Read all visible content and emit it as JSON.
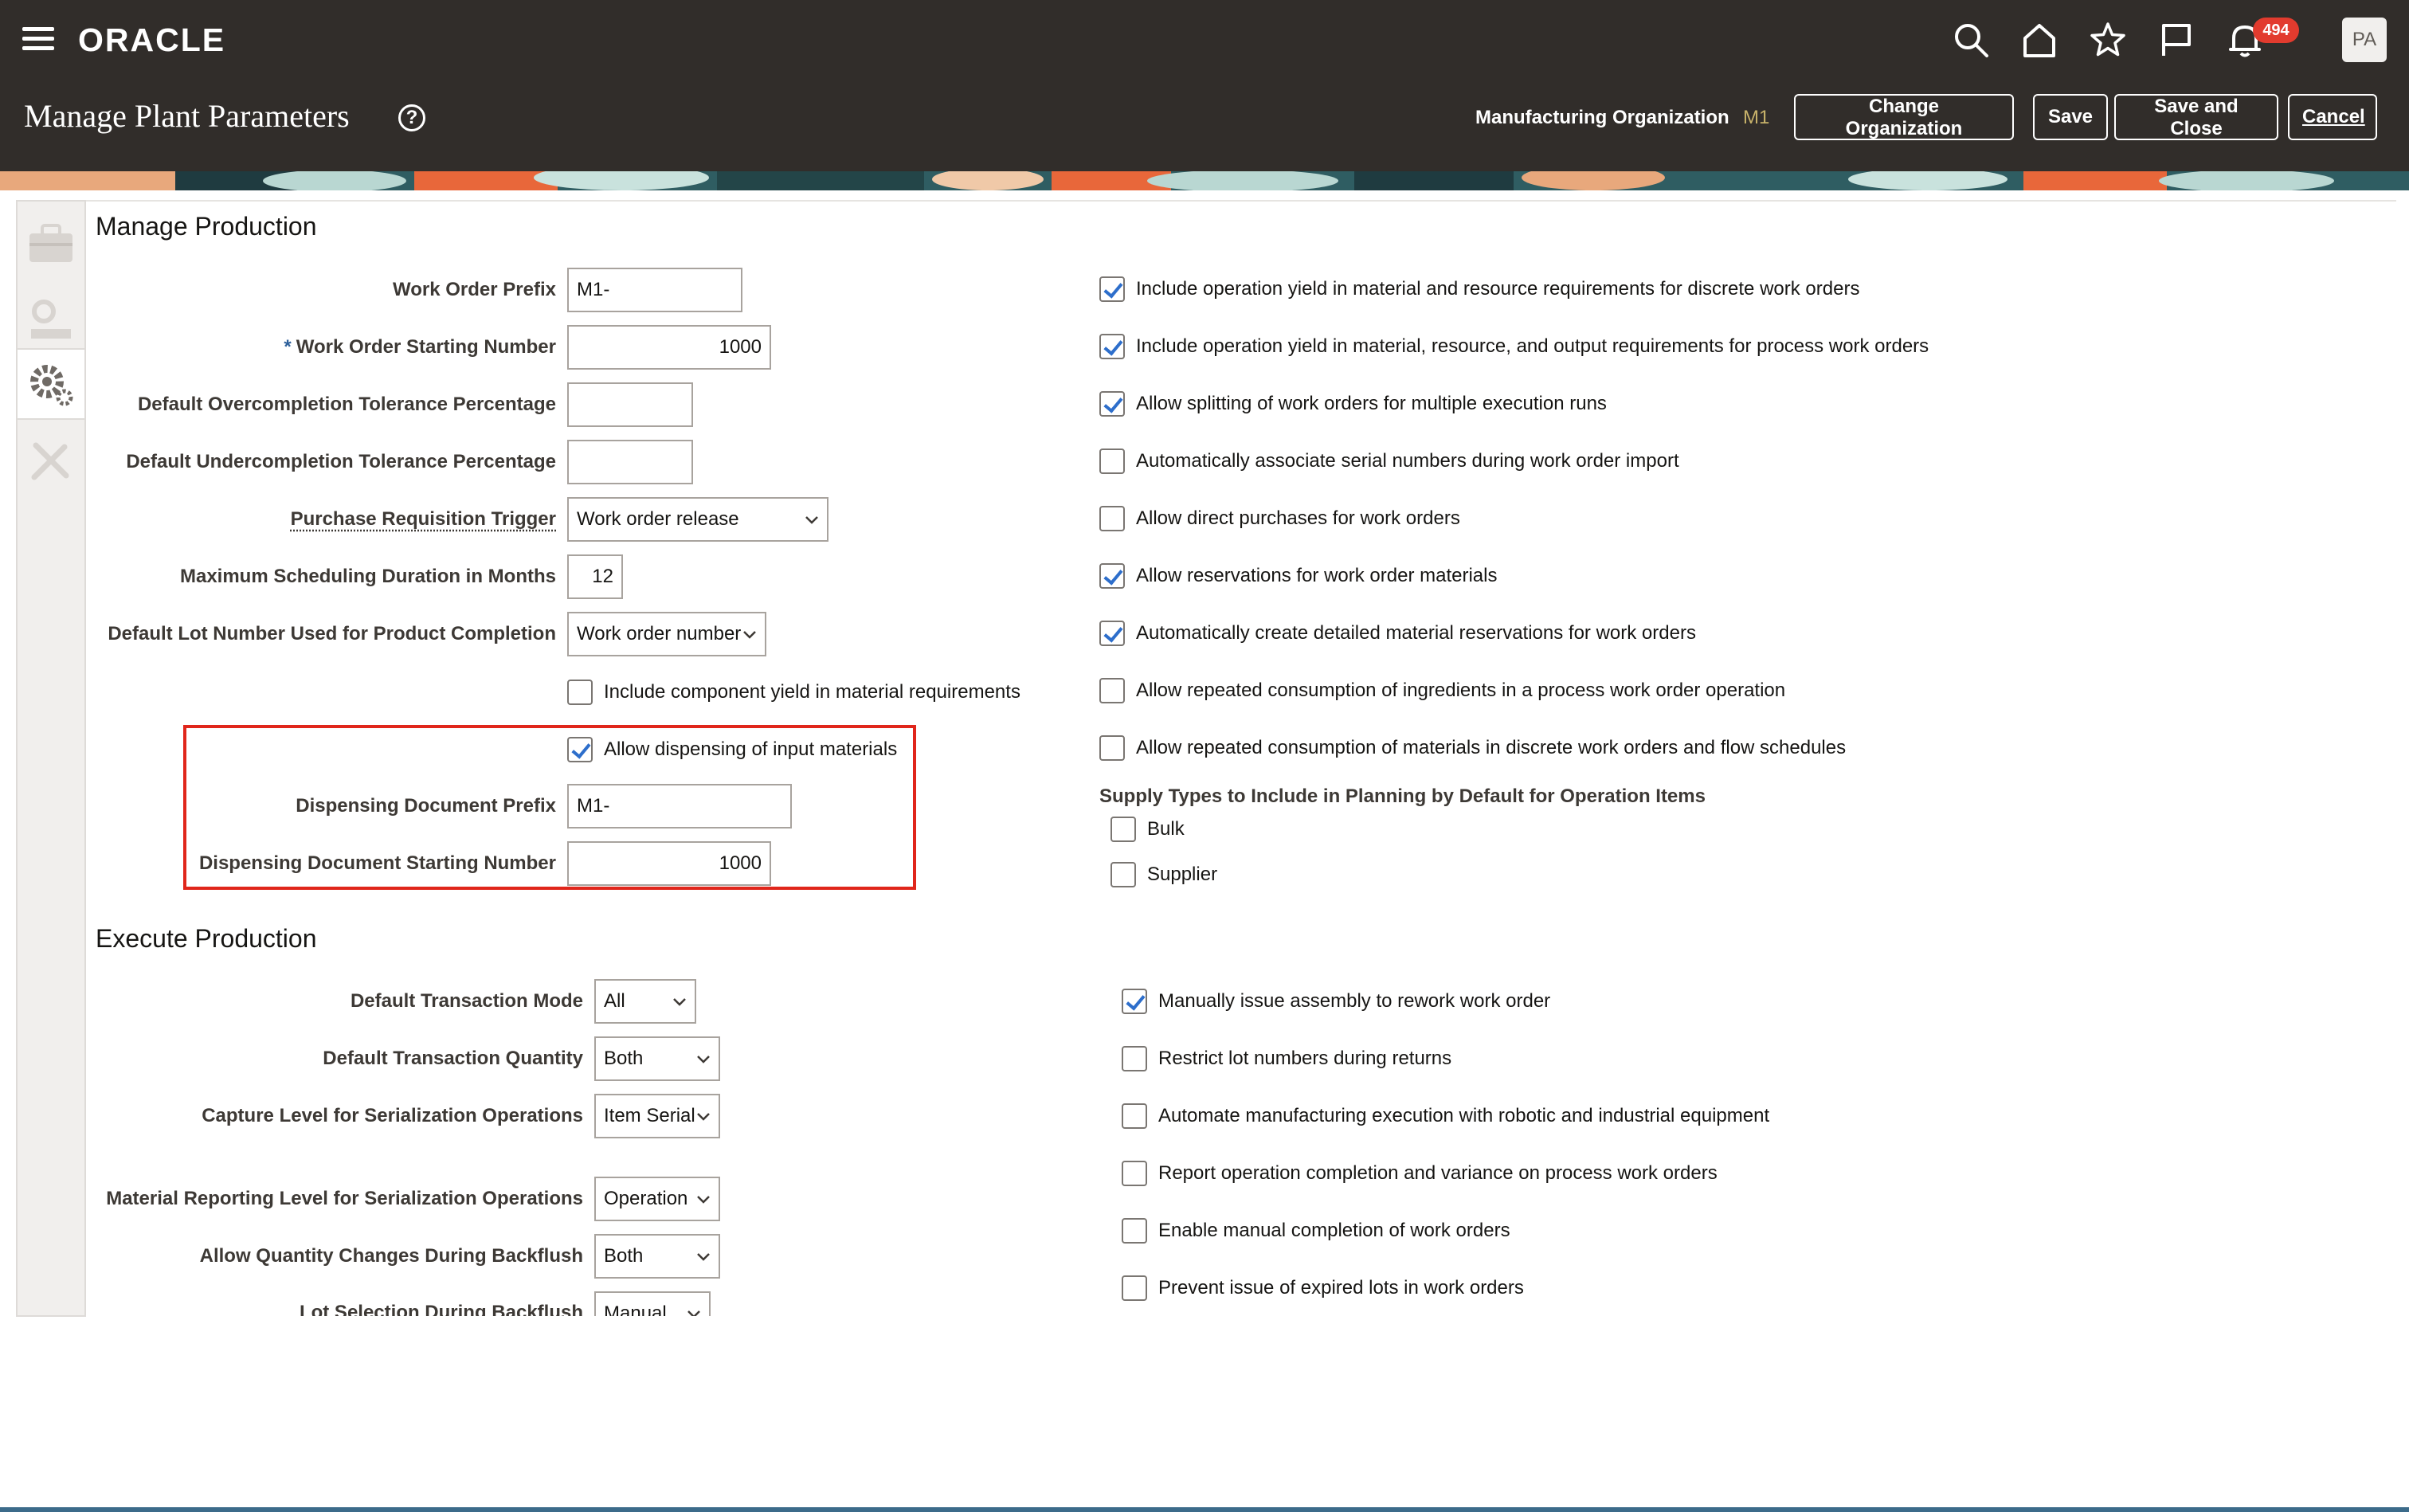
{
  "header": {
    "logo": "ORACLE",
    "notifications_count": "494",
    "avatar_initials": "PA",
    "page_title": "Manage Plant Parameters",
    "help_glyph": "?",
    "org_label": "Manufacturing Organization",
    "org_value": "M1",
    "buttons": {
      "change_org": "Change Organization",
      "save": "Save",
      "save_close": "Save and Close",
      "cancel": "Cancel"
    },
    "icons": [
      "menu-icon",
      "search-icon",
      "home-icon",
      "favorites-star-icon",
      "flag-icon",
      "notifications-bell-icon"
    ]
  },
  "manage_production": {
    "title": "Manage Production",
    "work_order_prefix": {
      "label": "Work Order Prefix",
      "value": "M1-"
    },
    "work_order_starting_number": {
      "label": "Work Order Starting Number",
      "value": "1000",
      "required_mark": "*"
    },
    "overcompletion": {
      "label": "Default Overcompletion Tolerance Percentage",
      "value": ""
    },
    "undercompletion": {
      "label": "Default Undercompletion Tolerance Percentage",
      "value": ""
    },
    "purchase_requisition_trigger": {
      "label": "Purchase Requisition Trigger",
      "value": "Work order release"
    },
    "max_scheduling_duration": {
      "label": "Maximum Scheduling Duration in Months",
      "value": "12"
    },
    "default_lot_number": {
      "label": "Default Lot Number Used for Product Completion",
      "value": "Work order number"
    },
    "include_component_yield": {
      "label": "Include component yield in material requirements",
      "checked": false
    },
    "allow_dispensing": {
      "label": "Allow dispensing of input materials",
      "checked": true
    },
    "dispensing_prefix": {
      "label": "Dispensing Document Prefix",
      "value": "M1-"
    },
    "dispensing_starting_number": {
      "label": "Dispensing Document Starting Number",
      "value": "1000"
    },
    "options": [
      {
        "label": "Include operation yield in material and resource requirements for discrete work orders",
        "checked": true
      },
      {
        "label": "Include operation yield in material, resource, and output requirements for process work orders",
        "checked": true
      },
      {
        "label": "Allow splitting of work orders for multiple execution runs",
        "checked": true
      },
      {
        "label": "Automatically associate serial numbers during work order import",
        "checked": false
      },
      {
        "label": "Allow direct purchases for work orders",
        "checked": false
      },
      {
        "label": "Allow reservations for work order materials",
        "checked": true
      },
      {
        "label": "Automatically create detailed material reservations for work orders",
        "checked": true
      },
      {
        "label": "Allow repeated consumption of ingredients in a process work order operation",
        "checked": false
      },
      {
        "label": "Allow repeated consumption of materials in discrete work orders and flow schedules",
        "checked": false
      }
    ],
    "supply_types": {
      "label": "Supply Types to Include in Planning by Default for Operation Items",
      "items": [
        {
          "label": "Bulk",
          "checked": false
        },
        {
          "label": "Supplier",
          "checked": false
        }
      ]
    }
  },
  "execute_production": {
    "title": "Execute Production",
    "transaction_mode": {
      "label": "Default Transaction Mode",
      "value": "All"
    },
    "transaction_quantity": {
      "label": "Default Transaction Quantity",
      "value": "Both"
    },
    "capture_level": {
      "label": "Capture Level for Serialization Operations",
      "value": "Item Serial"
    },
    "material_reporting_level": {
      "label": "Material Reporting Level for Serialization Operations",
      "value": "Operation"
    },
    "quantity_changes_backflush": {
      "label": "Allow Quantity Changes During Backflush",
      "value": "Both"
    },
    "lot_selection_backflush": {
      "label": "Lot Selection During Backflush",
      "value": "Manual"
    },
    "options": [
      {
        "label": "Manually issue assembly to rework work order",
        "checked": true
      },
      {
        "label": "Restrict lot numbers during returns",
        "checked": false
      },
      {
        "label": "Automate manufacturing execution with robotic and industrial equipment",
        "checked": false
      },
      {
        "label": "Report operation completion and variance on process work orders",
        "checked": false
      },
      {
        "label": "Enable manual completion of work orders",
        "checked": false
      },
      {
        "label": "Prevent issue of expired lots in work orders",
        "checked": false
      }
    ]
  },
  "colors": {
    "header_bg": "#312d2a",
    "accent_blue": "#2d6ecb",
    "highlight_red": "#e0261b",
    "badge_red": "#e23b2e",
    "org_value_gold": "#c8b26a"
  }
}
